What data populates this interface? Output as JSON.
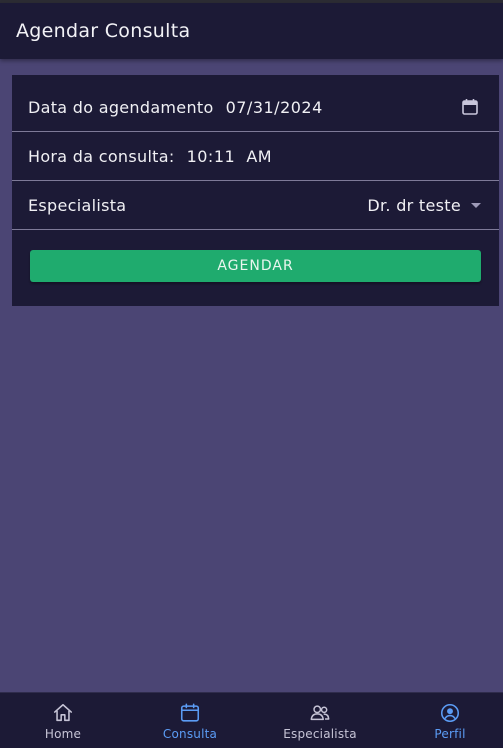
{
  "header": {
    "title": "Agendar Consulta"
  },
  "form": {
    "date_label": "Data do agendamento",
    "date_value": "07/31/2024",
    "time_label": "Hora da consulta:",
    "time_value": "10:11  AM",
    "specialist_label": "Especialista",
    "specialist_value": "Dr. dr teste",
    "submit_label": "AGENDAR"
  },
  "tabs": [
    {
      "label": "Home",
      "icon": "home-icon",
      "active": false
    },
    {
      "label": "Consulta",
      "icon": "calendar-icon",
      "active": true
    },
    {
      "label": "Especialista",
      "icon": "people-icon",
      "active": false
    },
    {
      "label": "Perfil",
      "icon": "person-circle-icon",
      "active": true
    }
  ],
  "colors": {
    "background": "#4b4574",
    "surface": "#1c1a36",
    "primary_button": "#1fab6e",
    "active_tab": "#5b9cf5"
  }
}
